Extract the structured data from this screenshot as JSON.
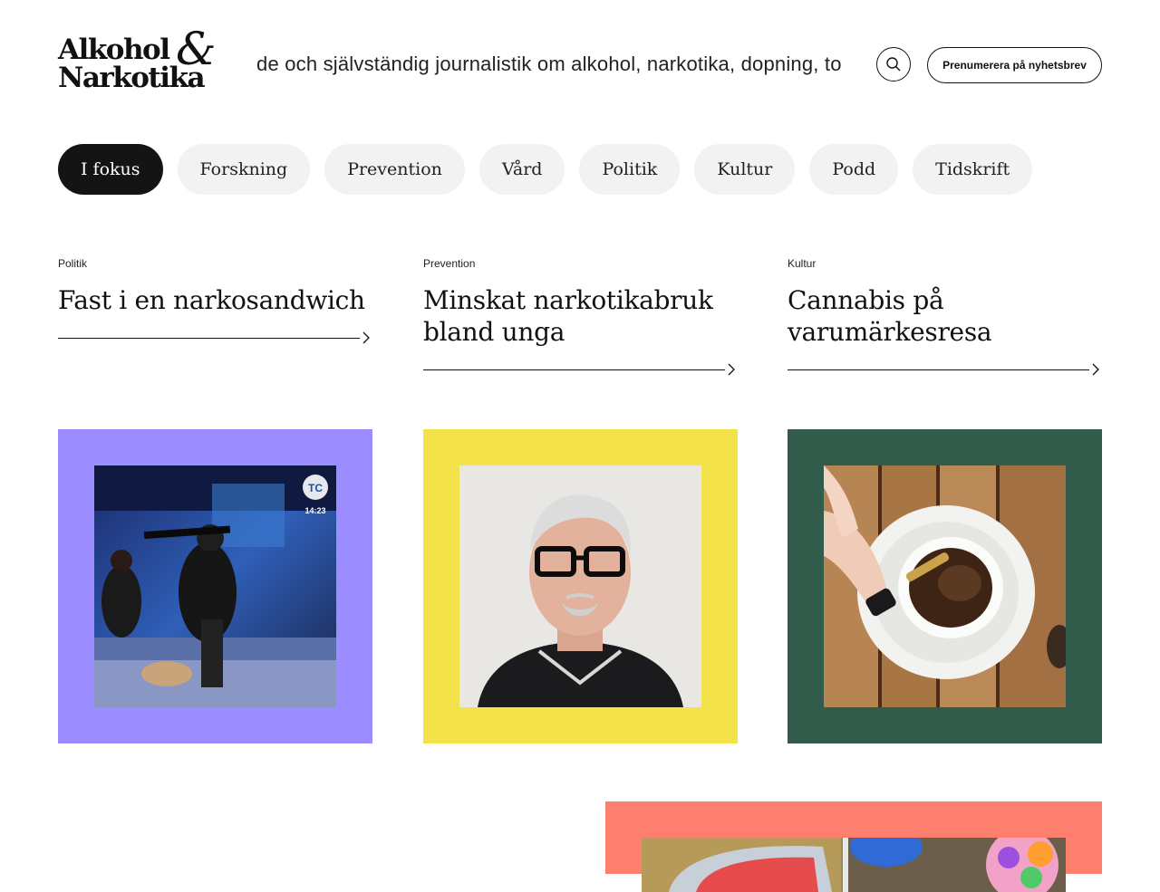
{
  "header": {
    "logo_line1": "Alkohol",
    "logo_line2": "Narkotika",
    "logo_amp": "&",
    "tagline": "Oberoende och självständig journalistik om alkohol, narkotika, dopning, tobak och spel",
    "search_icon": "search-icon",
    "subscribe_label": "Prenumerera på nyhetsbrev"
  },
  "nav": {
    "items": [
      {
        "label": "I fokus",
        "active": true
      },
      {
        "label": "Forskning"
      },
      {
        "label": "Prevention"
      },
      {
        "label": "Vård"
      },
      {
        "label": "Politik"
      },
      {
        "label": "Kultur"
      },
      {
        "label": "Podd"
      },
      {
        "label": "Tidskrift"
      }
    ]
  },
  "articles": [
    {
      "category": "Politik",
      "title": "Fast i en narkosandwich",
      "frame_color": "#9b8cff",
      "image": "tv-studio-armed-men-photo",
      "image_overlay": "TC",
      "image_time": "14:23"
    },
    {
      "category": "Prevention",
      "title": "Minskat narkotikabruk bland unga",
      "frame_color": "#f4e24a",
      "image": "man-with-glasses-portrait"
    },
    {
      "category": "Kultur",
      "title": "Cannabis på varumärkesresa",
      "frame_color": "#315b4b",
      "image": "cbd-drops-in-coffee-photo"
    }
  ],
  "bottom_feature": {
    "frame_color": "#ff7f6e",
    "image": "colorful-partial-photo"
  },
  "icons": {
    "arrow": "arrow-right-icon"
  }
}
